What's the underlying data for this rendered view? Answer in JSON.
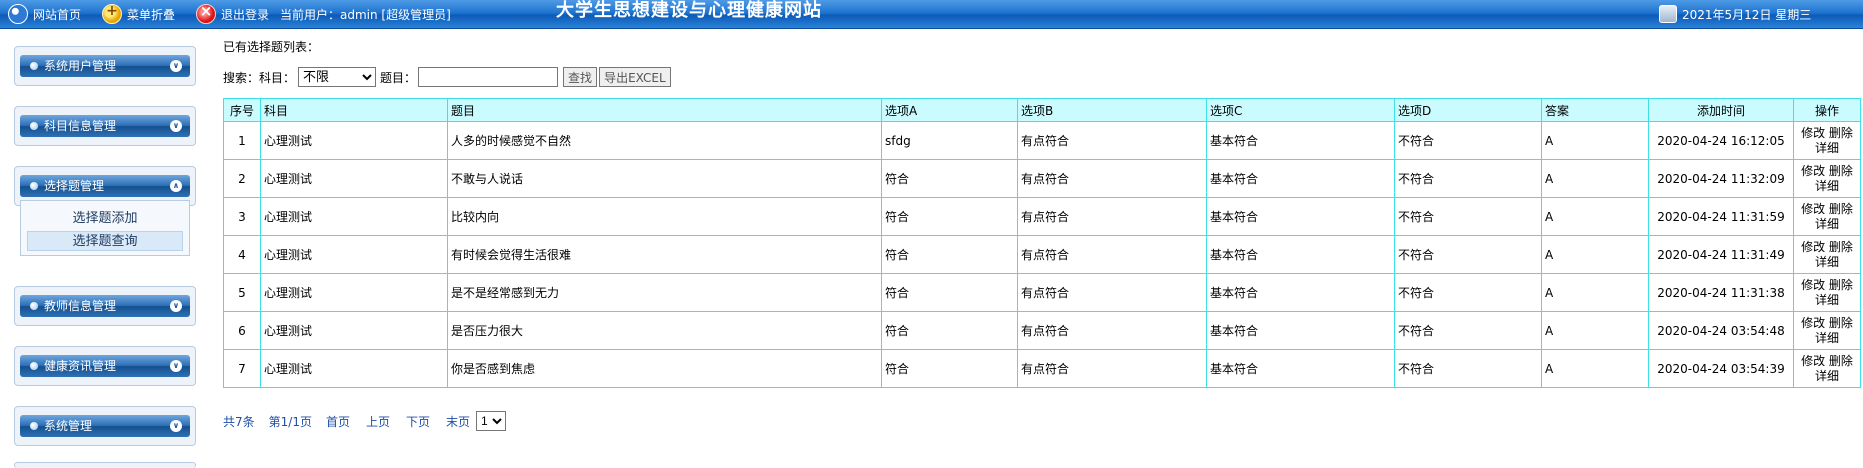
{
  "topbar": {
    "home": "网站首页",
    "fold": "菜单折叠",
    "logout": "退出登录",
    "current_user": "当前用户：admin [超级管理员]",
    "site_title": "大学生思想建设与心理健康网站",
    "date": "2021年5月12日 星期三"
  },
  "sidebar": {
    "menus": [
      "系统用户管理",
      "科目信息管理",
      "选择题管理",
      "教师信息管理",
      "健康资讯管理",
      "系统管理"
    ],
    "submenu": [
      "选择题添加",
      "选择题查询"
    ]
  },
  "main": {
    "list_title": "已有选择题列表：",
    "search": {
      "prefix": "搜索：",
      "subject_label": "科目：",
      "subject_selected": "不限",
      "question_label": "题目：",
      "question_value": "",
      "find_button": "查找",
      "export_button": "导出EXCEL"
    },
    "table": {
      "headers": [
        "序号",
        "科目",
        "题目",
        "选项A",
        "选项B",
        "选项C",
        "选项D",
        "答案",
        "添加时间",
        "操作"
      ],
      "rows": [
        [
          "1",
          "心理测试",
          "人多的时候感觉不自然",
          "sfdg",
          "有点符合",
          "基本符合",
          "不符合",
          "A",
          "2020-04-24 16:12:05"
        ],
        [
          "2",
          "心理测试",
          "不敢与人说话",
          "符合",
          "有点符合",
          "基本符合",
          "不符合",
          "A",
          "2020-04-24 11:32:09"
        ],
        [
          "3",
          "心理测试",
          "比较内向",
          "符合",
          "有点符合",
          "基本符合",
          "不符合",
          "A",
          "2020-04-24 11:31:59"
        ],
        [
          "4",
          "心理测试",
          "有时候会觉得生活很难",
          "符合",
          "有点符合",
          "基本符合",
          "不符合",
          "A",
          "2020-04-24 11:31:49"
        ],
        [
          "5",
          "心理测试",
          "是不是经常感到无力",
          "符合",
          "有点符合",
          "基本符合",
          "不符合",
          "A",
          "2020-04-24 11:31:38"
        ],
        [
          "6",
          "心理测试",
          "是否压力很大",
          "符合",
          "有点符合",
          "基本符合",
          "不符合",
          "A",
          "2020-04-24 03:54:48"
        ],
        [
          "7",
          "心理测试",
          "你是否感到焦虑",
          "符合",
          "有点符合",
          "基本符合",
          "不符合",
          "A",
          "2020-04-24 03:54:39"
        ]
      ],
      "ops": {
        "edit": "修改",
        "delete": "删除",
        "detail": "详细"
      }
    },
    "pager": {
      "total": "共7条",
      "page_info": "第1/1页",
      "first": "首页",
      "prev": "上页",
      "next": "下页",
      "last": "末页",
      "page_selected": "1"
    }
  },
  "icons": {
    "home": "globe-icon",
    "fold": "fold-menu-icon",
    "logout": "logout-icon",
    "clock": "clock-icon",
    "menu_toggle": "chevron-icon"
  },
  "colors": {
    "topbar": "#1f74cf",
    "grid_border": "#40e0e8",
    "header_bg": "#c9fbff",
    "link": "#1f4fa8"
  }
}
